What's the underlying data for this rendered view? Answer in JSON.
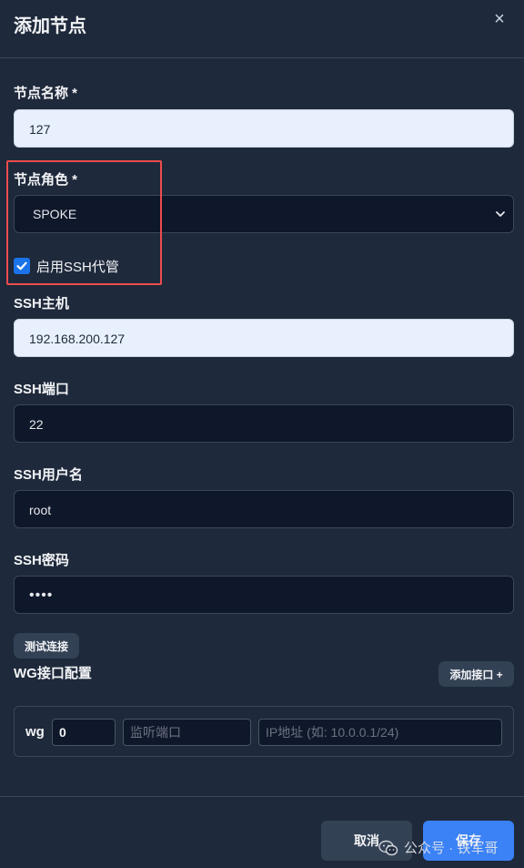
{
  "dialog": {
    "title": "添加节点",
    "close_glyph": "×"
  },
  "fields": {
    "node_name": {
      "label": "节点名称 *",
      "value": "127"
    },
    "node_role": {
      "label": "节点角色 *",
      "value": "SPOKE"
    },
    "ssh_enable": {
      "label": "启用SSH代管",
      "checked": true
    },
    "ssh_host": {
      "label": "SSH主机",
      "value": "192.168.200.127"
    },
    "ssh_port": {
      "label": "SSH端口",
      "value": "22"
    },
    "ssh_user": {
      "label": "SSH用户名",
      "value": "root"
    },
    "ssh_password": {
      "label": "SSH密码",
      "value": "••••"
    }
  },
  "test_connection_label": "测试连接",
  "wg": {
    "section_label": "WG接口配置",
    "add_interface_label": "添加接口 +",
    "interface_prefix": "wg",
    "interface_index": "0",
    "listen_port_placeholder": "监听端口",
    "ip_placeholder": "IP地址 (如: 10.0.0.1/24)"
  },
  "footer": {
    "cancel_label": "取消",
    "save_label": "保存"
  },
  "watermark": "公众号 · 铁军哥",
  "colors": {
    "background": "#1e293b",
    "input_dark": "#0f172a",
    "input_light": "#e8f0fe",
    "primary": "#3b82f6",
    "highlight": "#ef4d4d"
  },
  "icons": {
    "close": "close-icon",
    "chevron": "chevron-down-icon",
    "check": "check-icon",
    "wechat": "wechat-icon"
  }
}
